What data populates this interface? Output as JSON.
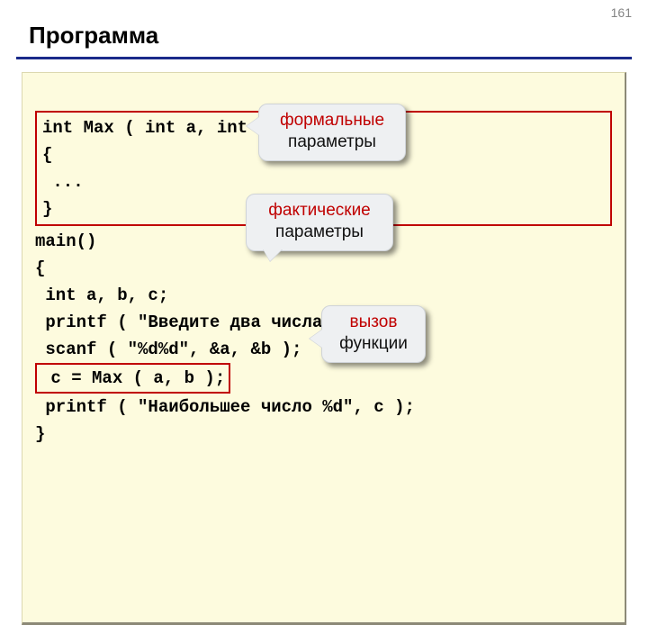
{
  "page_number": "161",
  "title": "Программа",
  "code": {
    "max_block": "int Max ( int a, int b )\n{\n ...\n}",
    "main_before": "main()\n{\n int a, b, c;\n printf ( \"Введите два числа\\n\" );\n scanf ( \"%d%d\", &a, &b );",
    "call_line": " c = Max ( a, b );",
    "main_after": " printf ( \"Наибольшее число %d\", c );\n}"
  },
  "callouts": {
    "formal": {
      "line1": "формальные",
      "line2": "параметры"
    },
    "actual": {
      "line1": "фактические",
      "line2": "параметры"
    },
    "call": {
      "line1": "вызов",
      "line2": "функции"
    }
  }
}
